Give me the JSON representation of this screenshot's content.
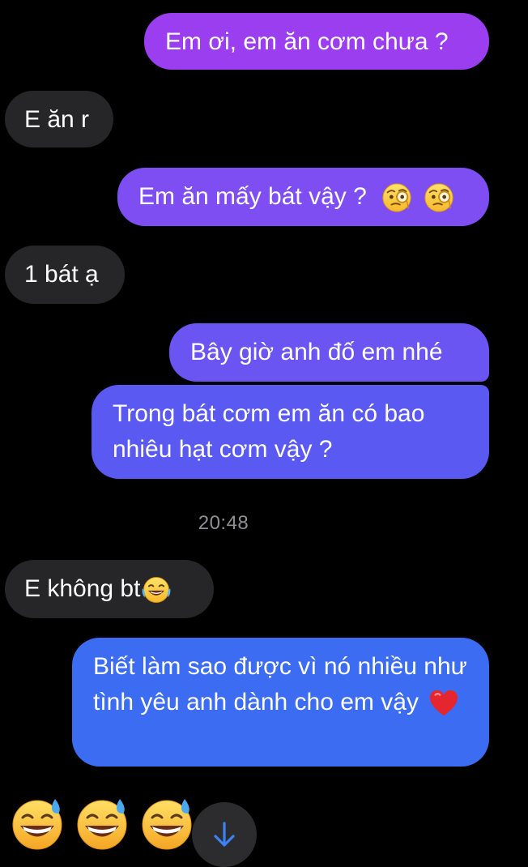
{
  "messages": [
    {
      "id": "m1",
      "side": "out",
      "text": "Em ơi, em ăn cơm chưa ?"
    },
    {
      "id": "m2",
      "side": "in",
      "text": "E ăn r"
    },
    {
      "id": "m3",
      "side": "out",
      "text": "Em ăn mấy bát vậy ?",
      "emojis": [
        "monocle-face-emoji",
        "monocle-face-emoji"
      ]
    },
    {
      "id": "m4",
      "side": "in",
      "text": "1 bát ạ"
    },
    {
      "id": "m5",
      "side": "out",
      "text": "Bây giờ anh đố em nhé"
    },
    {
      "id": "m6",
      "side": "out",
      "text": "Trong bát cơm em ăn có bao nhiêu hạt cơm vậy ?"
    },
    {
      "id": "m8",
      "side": "in",
      "text": "E không bt",
      "emojis": [
        "tears-of-joy-emoji"
      ]
    },
    {
      "id": "m9",
      "side": "out",
      "text": "Biết làm sao được vì nó nhiều như tình yêu anh dành cho em vậy",
      "emojis": [
        "red-heart-emoji"
      ]
    }
  ],
  "timestamp": "20:48",
  "reactions_row": [
    "grinning-sweat-emoji",
    "grinning-sweat-emoji",
    "grinning-sweat-emoji"
  ],
  "scroll_button_icon": "arrow-down-icon",
  "colors": {
    "background": "#000000",
    "incoming_bubble": "#262628",
    "outgoing_top": "#9b3cf0",
    "outgoing_bottom": "#3b6ef2",
    "timestamp": "#8e8e93",
    "scroll_arrow": "#3b82f6"
  }
}
